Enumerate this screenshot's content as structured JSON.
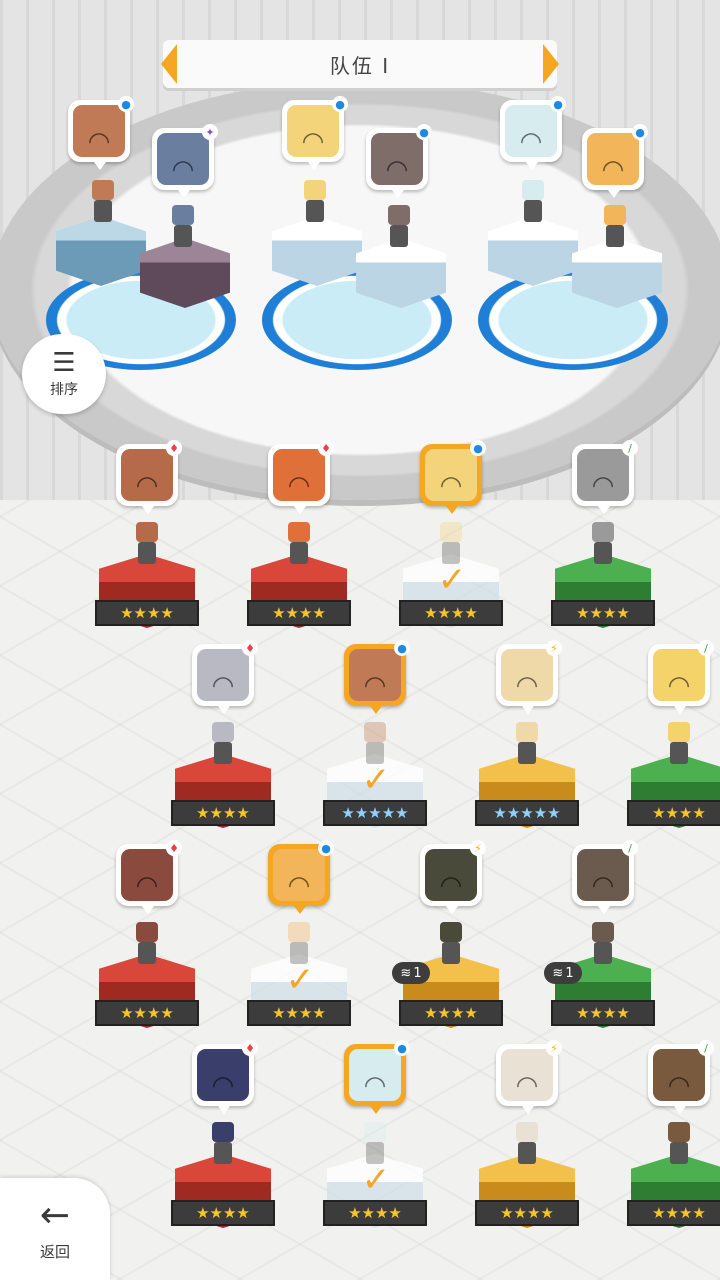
{
  "header": {
    "team_title": "队伍 I"
  },
  "controls": {
    "sort_label": "排序",
    "back_label": "返回"
  },
  "colors": {
    "accent": "#f5a623",
    "attr_fire": "#e8414b",
    "attr_water": "#1e88e5",
    "attr_wind": "#43a047",
    "attr_light": "#f2b500",
    "attr_dark": "#7e57c2"
  },
  "team_slots": [
    {
      "attribute": "water",
      "icon": "water-drop-icon",
      "bg": "#c07a55"
    },
    {
      "attribute": "dark",
      "icon": "dark-star-icon",
      "bg": "#6a7fa0"
    },
    {
      "attribute": "water",
      "icon": "water-drop-icon",
      "bg": "#f3d47a"
    },
    {
      "attribute": "water",
      "icon": "water-drop-icon",
      "bg": "#7f6d6a"
    },
    {
      "attribute": "water",
      "icon": "water-drop-icon",
      "bg": "#d6ecef"
    },
    {
      "attribute": "water",
      "icon": "water-drop-icon",
      "bg": "#f3b55a"
    }
  ],
  "heroes": [
    {
      "attribute": "fire",
      "stars": "★★★★",
      "pedestal": "red",
      "selected": false,
      "bg": "#b56b4a"
    },
    {
      "attribute": "fire",
      "stars": "★★★★",
      "pedestal": "red",
      "selected": false,
      "bg": "#e0703a"
    },
    {
      "attribute": "water",
      "stars": "★★★★",
      "pedestal": "ghost",
      "selected": true,
      "bg": "#f3d47a"
    },
    {
      "attribute": "wind",
      "stars": "★★★★",
      "pedestal": "green",
      "selected": false,
      "bg": "#9a9a9a"
    },
    {
      "attribute": "fire",
      "stars": "★★★★",
      "pedestal": "red",
      "selected": false,
      "bg": "#b9b9c4"
    },
    {
      "attribute": "water",
      "stars": "★★★★★",
      "pedestal": "ghost",
      "selected": true,
      "bg": "#c07a55",
      "rainbow": true
    },
    {
      "attribute": "light",
      "stars": "★★★★★",
      "pedestal": "gold",
      "selected": false,
      "bg": "#f0d9a8",
      "rainbow": true
    },
    {
      "attribute": "wind",
      "stars": "★★★★",
      "pedestal": "green",
      "selected": false,
      "bg": "#f3d36a"
    },
    {
      "attribute": "fire",
      "stars": "★★★★",
      "pedestal": "red",
      "selected": false,
      "bg": "#8a4a3e"
    },
    {
      "attribute": "water",
      "stars": "★★★★",
      "pedestal": "ghost",
      "selected": true,
      "bg": "#f3b55a"
    },
    {
      "attribute": "light",
      "stars": "★★★★",
      "pedestal": "gold",
      "selected": false,
      "bg": "#4a4a3a",
      "level": "1"
    },
    {
      "attribute": "wind",
      "stars": "★★★★",
      "pedestal": "green",
      "selected": false,
      "bg": "#6b5a4e",
      "level": "1"
    },
    {
      "attribute": "fire",
      "stars": "★★★★",
      "pedestal": "red",
      "selected": false,
      "bg": "#3a3e6a"
    },
    {
      "attribute": "water",
      "stars": "★★★★",
      "pedestal": "ghost",
      "selected": true,
      "bg": "#d6ecef"
    },
    {
      "attribute": "light",
      "stars": "★★★★",
      "pedestal": "gold",
      "selected": false,
      "bg": "#e9e2d4"
    },
    {
      "attribute": "wind",
      "stars": "★★★★",
      "pedestal": "green",
      "selected": false,
      "bg": "#7a5a3e"
    }
  ]
}
